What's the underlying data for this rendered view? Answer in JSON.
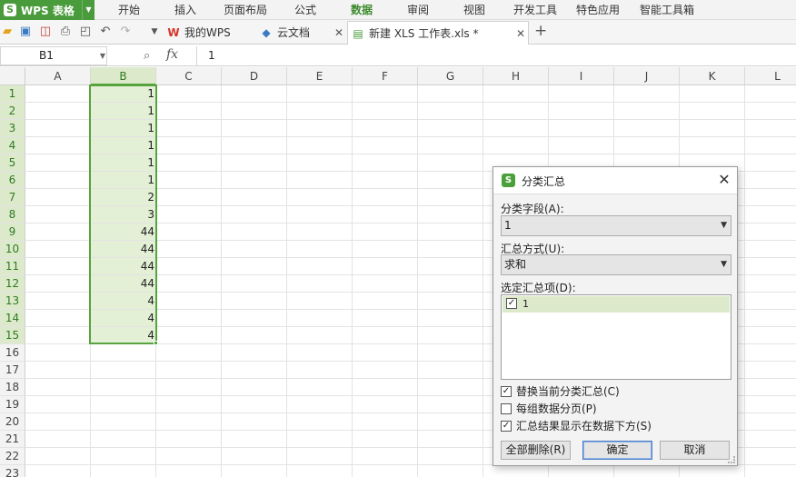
{
  "menubar": {
    "app_title": "WPS 表格",
    "app_logo": "S",
    "items": [
      "开始",
      "插入",
      "页面布局",
      "公式",
      "数据",
      "审阅",
      "视图",
      "开发工具",
      "特色应用",
      "智能工具箱"
    ],
    "active_item": "数据"
  },
  "toolbar": {
    "icons": [
      "open-folder-icon",
      "save-icon",
      "export-pdf-icon",
      "print-icon",
      "print-preview-icon",
      "undo-icon",
      "redo-icon",
      "more-dropdown-icon"
    ]
  },
  "tabs": [
    {
      "label": "我的WPS",
      "icon": "wps-logo-icon",
      "closable": false
    },
    {
      "label": "云文档",
      "icon": "cloud-doc-icon",
      "closable": true
    },
    {
      "label": "新建 XLS 工作表.xls *",
      "icon": "spreadsheet-file-icon",
      "closable": true,
      "current": true
    }
  ],
  "formula_bar": {
    "name_box": "B1",
    "fx": "fx",
    "value": "1"
  },
  "sheet": {
    "columns": [
      "A",
      "B",
      "C",
      "D",
      "E",
      "F",
      "G",
      "H",
      "I",
      "J",
      "K",
      "L"
    ],
    "selected_column": "B",
    "rows": [
      "1",
      "2",
      "3",
      "4",
      "5",
      "6",
      "7",
      "8",
      "9",
      "10",
      "11",
      "12",
      "13",
      "14",
      "15",
      "16",
      "17",
      "18",
      "19",
      "20",
      "21",
      "22",
      "23"
    ],
    "selected_rows": [
      "1",
      "2",
      "3",
      "4",
      "5",
      "6",
      "7",
      "8",
      "9",
      "10",
      "11",
      "12",
      "13",
      "14",
      "15"
    ],
    "column_b_values": [
      "1",
      "1",
      "1",
      "1",
      "1",
      "1",
      "2",
      "3",
      "44",
      "44",
      "44",
      "44",
      "4",
      "4",
      "4"
    ],
    "selection_color": "#57a33e"
  },
  "dialog": {
    "title": "分类汇总",
    "logo": "S",
    "close": "✕",
    "field_label": "分类字段(A):",
    "field_value": "1",
    "method_label": "汇总方式(U):",
    "method_value": "求和",
    "items_label": "选定汇总项(D):",
    "items": [
      {
        "label": "1",
        "checked": true
      }
    ],
    "options": [
      {
        "label": "替换当前分类汇总(C)",
        "checked": true
      },
      {
        "label": "每组数据分页(P)",
        "checked": false
      },
      {
        "label": "汇总结果显示在数据下方(S)",
        "checked": true
      }
    ],
    "buttons": {
      "remove_all": "全部删除(R)",
      "ok": "确定",
      "cancel": "取消"
    }
  }
}
